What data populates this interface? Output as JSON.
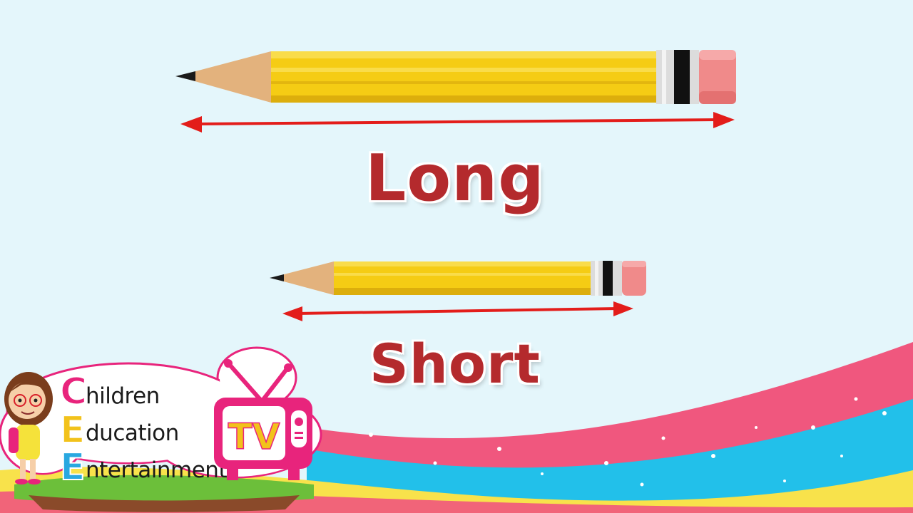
{
  "labels": {
    "long": "Long",
    "short": "Short"
  },
  "logo": {
    "initials": [
      "C",
      "E",
      "E"
    ],
    "lines": [
      "hildren",
      "ducation",
      "ntertainment"
    ],
    "tv": "TV",
    "colors": {
      "c": "#e8247c",
      "e1": "#f2c21b",
      "e2": "#29a8e0",
      "tv_frame": "#e8247c",
      "tv_text": "#f2c21b"
    }
  },
  "colors": {
    "background": "#e4f6fb",
    "label": "#b42a2d",
    "arrow": "#e31d1a",
    "pencil_body": "#f5cc14",
    "eraser": "#f08a8a",
    "wave_pink": "#f0577e",
    "wave_blue": "#22c0ea",
    "wave_yellow": "#f8e24b"
  }
}
